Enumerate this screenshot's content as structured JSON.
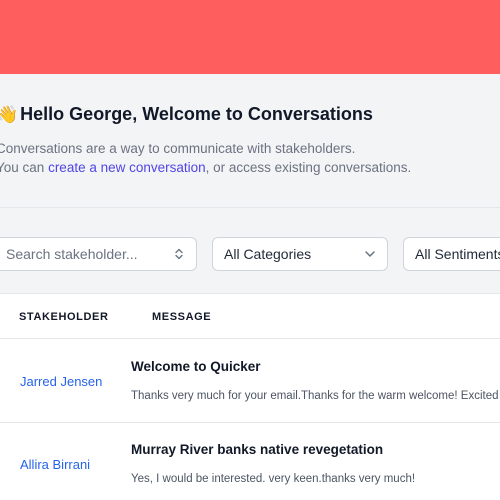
{
  "header": {
    "wave_emoji": "👋",
    "greeting": "Hello George, Welcome to Conversations",
    "line1": "Conversations are a way to communicate with stakeholders.",
    "line2_prefix": "You can ",
    "line2_link": "create a new conversation",
    "line2_suffix": ", or access existing conversations."
  },
  "filters": {
    "search_placeholder": "Search stakeholder...",
    "category": "All Categories",
    "sentiment": "All Sentiments"
  },
  "table": {
    "columns": [
      "STAKEHOLDER",
      "MESSAGE"
    ],
    "rows": [
      {
        "stakeholder": "Jarred Jensen",
        "subject": "Welcome to Quicker",
        "message": "Thanks very much for your email.Thanks for the warm welcome! Excited"
      },
      {
        "stakeholder": "Allira Birrani",
        "subject": "Murray River banks native revegetation",
        "message": "Yes, I would be interested. very keen.thanks very much!"
      }
    ]
  },
  "colors": {
    "banner": "#fe5e5e",
    "link": "#4f46e5",
    "stakeholder_link": "#2563eb"
  }
}
